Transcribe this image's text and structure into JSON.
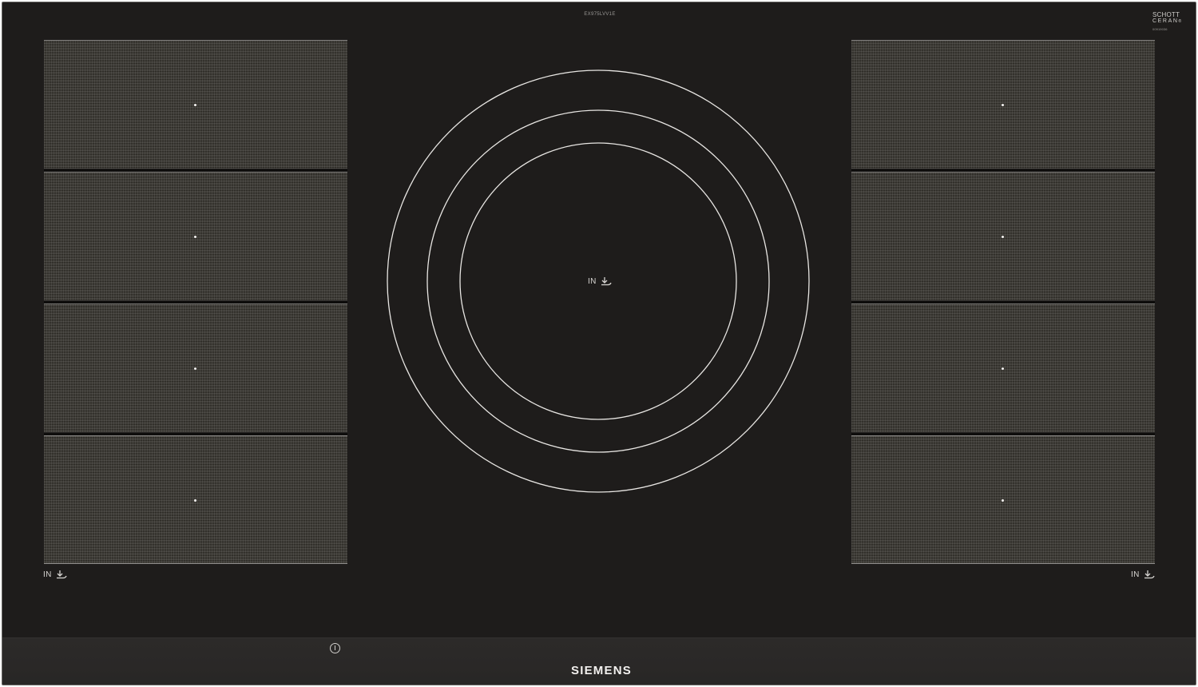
{
  "cooktop": {
    "model_number": "EX975LVV1E",
    "glass_brand": {
      "line1": "SCHOTT",
      "line2": "CERAN",
      "registered": "®",
      "code": "00919036"
    },
    "flex_zone_left": {
      "pads": 4,
      "induction_label": "IN"
    },
    "flex_zone_right": {
      "pads": 4,
      "induction_label": "IN"
    },
    "center_zone": {
      "rings": 3,
      "induction_label": "IN"
    },
    "controls": {
      "power_icon": "power-icon"
    },
    "brand": "SIEMENS"
  },
  "colors": {
    "glass": "#1e1c1b",
    "markings": "#e8e6e3",
    "strip": "#2a2827"
  }
}
